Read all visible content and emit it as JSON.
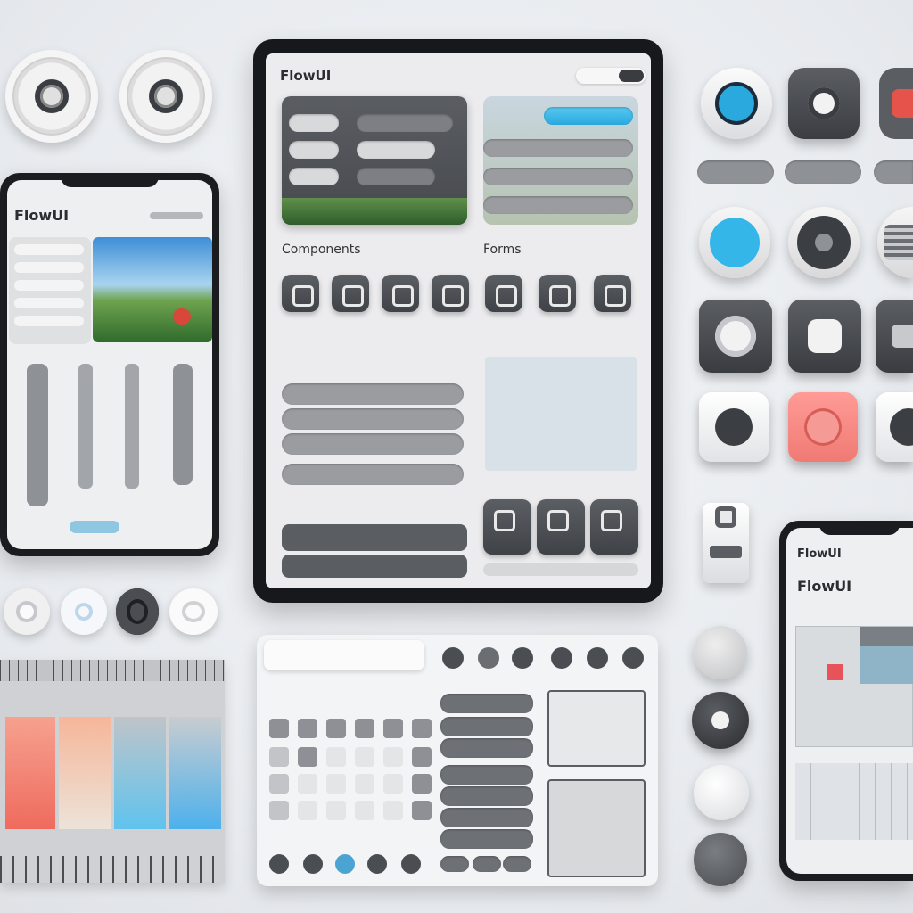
{
  "brand": "FlowUI",
  "tablet": {
    "brand": "FlowUI",
    "section_components": "Components",
    "section_forms": "Forms"
  },
  "phone_left": {
    "brand": "FlowUI"
  },
  "phone_right": {
    "brand": "FlowUI"
  },
  "colors": {
    "accent_blue": "#2aa9de",
    "accent_red": "#f07a74",
    "dark_surface": "#3f4246",
    "light_surface": "#ececee",
    "bezel": "#16181b"
  },
  "icons": [
    "fan-icon",
    "power-icon",
    "toggle-icon",
    "slider-icon",
    "camera-icon"
  ]
}
